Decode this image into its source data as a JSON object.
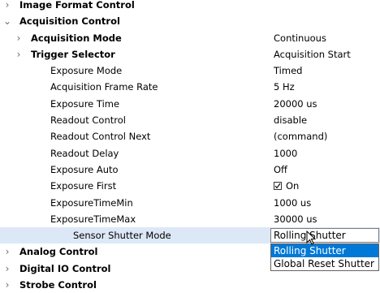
{
  "tree": {
    "rows": [
      {
        "label": "Image Format Control",
        "value": "",
        "arrow": "›",
        "indent": 1,
        "bold": true
      },
      {
        "label": "Acquisition Control",
        "value": "",
        "arrow": "⌄",
        "indent": 1,
        "bold": true
      },
      {
        "label": "Acquisition Mode",
        "value": "Continuous",
        "arrow": "›",
        "indent": 2,
        "bold": true
      },
      {
        "label": "Trigger Selector",
        "value": "Acquisition Start",
        "arrow": "›",
        "indent": 2,
        "bold": true
      },
      {
        "label": "Exposure Mode",
        "value": "Timed",
        "arrow": "",
        "indent": 3,
        "bold": false
      },
      {
        "label": "Acquisition Frame Rate",
        "value": "5 Hz",
        "arrow": "",
        "indent": 3,
        "bold": false
      },
      {
        "label": "Exposure Time",
        "value": "20000 us",
        "arrow": "",
        "indent": 3,
        "bold": false
      },
      {
        "label": "Readout Control",
        "value": "disable",
        "arrow": "",
        "indent": 3,
        "bold": false
      },
      {
        "label": "Readout Control Next",
        "value": "(command)",
        "arrow": "",
        "indent": 3,
        "bold": false
      },
      {
        "label": "Readout Delay",
        "value": "1000",
        "arrow": "",
        "indent": 3,
        "bold": false
      },
      {
        "label": "Exposure Auto",
        "value": "Off",
        "arrow": "",
        "indent": 3,
        "bold": false
      },
      {
        "label": "Exposure First",
        "value": "On",
        "arrow": "",
        "indent": 3,
        "bold": false,
        "checkbox": true
      },
      {
        "label": "ExposureTimeMin",
        "value": "1000 us",
        "arrow": "",
        "indent": 3,
        "bold": false
      },
      {
        "label": "ExposureTimeMax",
        "value": "30000 us",
        "arrow": "",
        "indent": 3,
        "bold": false
      },
      {
        "label": "Sensor Shutter Mode",
        "value": "",
        "arrow": "",
        "indent": 4,
        "bold": false,
        "selected": true
      },
      {
        "label": "Analog Control",
        "value": "",
        "arrow": "›",
        "indent": 1,
        "bold": true
      },
      {
        "label": "Digital IO Control",
        "value": "",
        "arrow": "›",
        "indent": 1,
        "bold": true
      },
      {
        "label": "Strobe Control",
        "value": "",
        "arrow": "›",
        "indent": 1,
        "bold": true
      }
    ]
  },
  "sensor_shutter": {
    "current": "Rolling Shutter",
    "options": [
      "Rolling Shutter",
      "Global Reset Shutter"
    ],
    "highlighted_index": 0
  },
  "colors": {
    "selection": "#dde8f7",
    "highlight": "#0078d7"
  }
}
